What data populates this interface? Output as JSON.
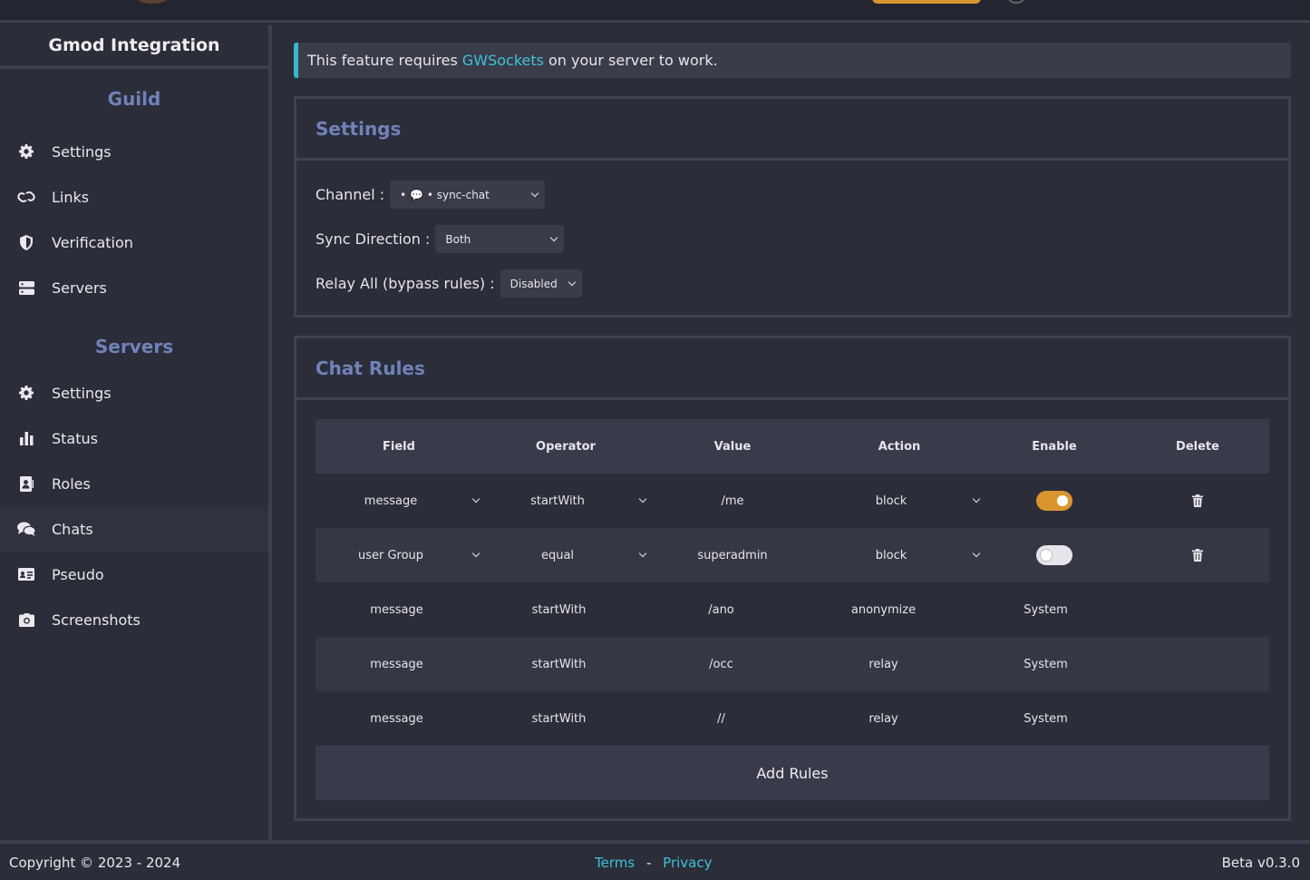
{
  "sidebar": {
    "title": "Gmod Integration",
    "guild_section": "Guild",
    "guild_items": [
      {
        "label": "Settings",
        "icon": "gear-icon"
      },
      {
        "label": "Links",
        "icon": "link-icon"
      },
      {
        "label": "Verification",
        "icon": "shield-icon"
      },
      {
        "label": "Servers",
        "icon": "server-icon"
      }
    ],
    "servers_section": "Servers",
    "server_items": [
      {
        "label": "Settings",
        "icon": "gear-icon"
      },
      {
        "label": "Status",
        "icon": "bar-chart-icon"
      },
      {
        "label": "Roles",
        "icon": "id-badge-icon"
      },
      {
        "label": "Chats",
        "icon": "chat-icon",
        "active": true
      },
      {
        "label": "Pseudo",
        "icon": "id-card-icon"
      },
      {
        "label": "Screenshots",
        "icon": "camera-icon"
      }
    ]
  },
  "notice": {
    "prefix": "This feature requires",
    "link": "GWSockets",
    "suffix": "on your server to work."
  },
  "settings": {
    "title": "Settings",
    "channel_label": "Channel :",
    "channel_value": "• 💬 • sync-chat",
    "sync_label": "Sync Direction :",
    "sync_value": "Both",
    "relay_label": "Relay All (bypass rules) :",
    "relay_value": "Disabled"
  },
  "rules": {
    "title": "Chat Rules",
    "headers": {
      "field": "Field",
      "operator": "Operator",
      "value": "Value",
      "action": "Action",
      "enable": "Enable",
      "delete": "Delete"
    },
    "editable_rows": [
      {
        "field": "message",
        "operator": "startWith",
        "value": "/me",
        "action": "block",
        "enabled": true
      },
      {
        "field": "user Group",
        "operator": "equal",
        "value": "superadmin",
        "action": "block",
        "enabled": false
      }
    ],
    "system_rows": [
      {
        "field": "message",
        "operator": "startWith",
        "value": "/ano",
        "action": "anonymize",
        "enable": "System"
      },
      {
        "field": "message",
        "operator": "startWith",
        "value": "/occ",
        "action": "relay",
        "enable": "System"
      },
      {
        "field": "message",
        "operator": "startWith",
        "value": "//",
        "action": "relay",
        "enable": "System"
      }
    ],
    "add_label": "Add Rules"
  },
  "footer": {
    "copyright": "Copyright © 2023 - 2024",
    "terms": "Terms",
    "separator": "-",
    "privacy": "Privacy",
    "version": "Beta v0.3.0"
  },
  "colors": {
    "accent": "#7182b9",
    "link": "#3ec2d6",
    "toggle_on": "#d9962f",
    "background": "#2b2d39"
  }
}
